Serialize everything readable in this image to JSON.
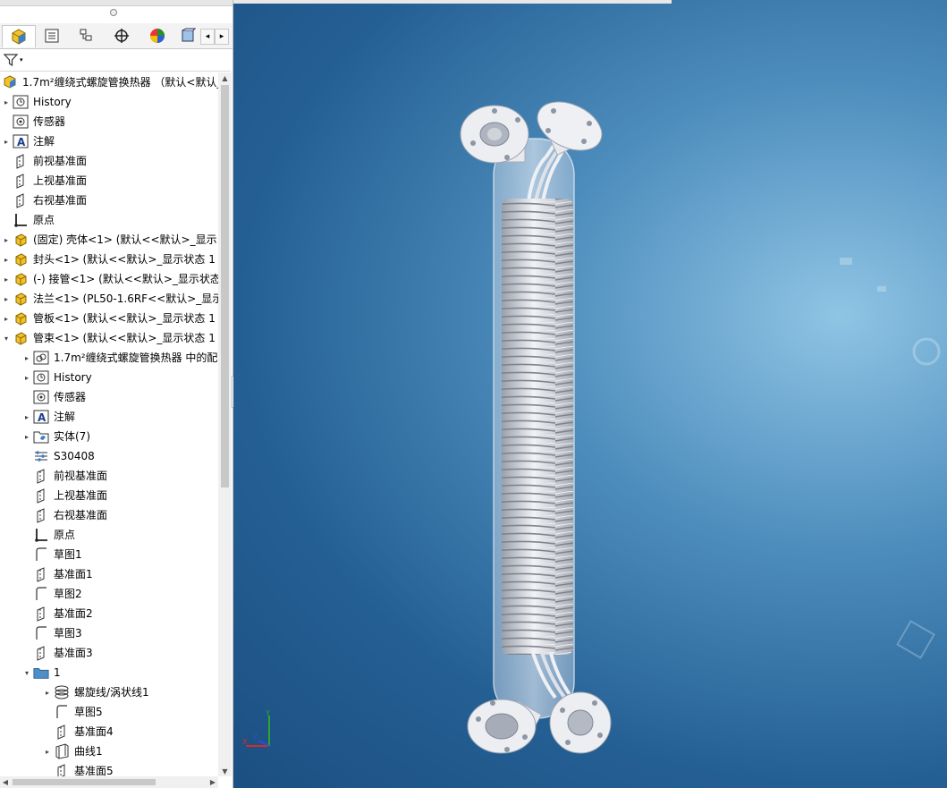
{
  "tree": {
    "root": "1.7m²缠绕式螺旋管换热器 （默认<默认_显",
    "items": [
      {
        "label": "History",
        "arrow": "▸",
        "icon": "history-icon",
        "indent": 0
      },
      {
        "label": "传感器",
        "arrow": "",
        "icon": "sensor-icon",
        "indent": 0
      },
      {
        "label": "注解",
        "arrow": "▸",
        "icon": "annotation-icon",
        "indent": 0
      },
      {
        "label": "前视基准面",
        "arrow": "",
        "icon": "plane-icon",
        "indent": 0
      },
      {
        "label": "上视基准面",
        "arrow": "",
        "icon": "plane-icon",
        "indent": 0
      },
      {
        "label": "右视基准面",
        "arrow": "",
        "icon": "plane-icon",
        "indent": 0
      },
      {
        "label": "原点",
        "arrow": "",
        "icon": "origin-icon",
        "indent": 0
      },
      {
        "label": "(固定) 壳体<1> (默认<<默认>_显示",
        "arrow": "▸",
        "icon": "part-icon",
        "indent": 0
      },
      {
        "label": "封头<1> (默认<<默认>_显示状态 1",
        "arrow": "▸",
        "icon": "part-icon",
        "indent": 0
      },
      {
        "label": "(-) 接管<1> (默认<<默认>_显示状态",
        "arrow": "▸",
        "icon": "part-icon",
        "indent": 0
      },
      {
        "label": "法兰<1> (PL50-1.6RF<<默认>_显示",
        "arrow": "▸",
        "icon": "part-icon",
        "indent": 0
      },
      {
        "label": "管板<1> (默认<<默认>_显示状态 1",
        "arrow": "▸",
        "icon": "part-icon",
        "indent": 0
      },
      {
        "label": "管束<1> (默认<<默认>_显示状态 1",
        "arrow": "▾",
        "icon": "part-icon",
        "indent": 0
      },
      {
        "label": "1.7m²缠绕式螺旋管换热器 中的配",
        "arrow": "▸",
        "icon": "mate-icon",
        "indent": 1
      },
      {
        "label": "History",
        "arrow": "▸",
        "icon": "history-icon",
        "indent": 1
      },
      {
        "label": "传感器",
        "arrow": "",
        "icon": "sensor-icon",
        "indent": 1
      },
      {
        "label": "注解",
        "arrow": "▸",
        "icon": "annotation-icon",
        "indent": 1
      },
      {
        "label": "实体(7)",
        "arrow": "▸",
        "icon": "solid-folder-icon",
        "indent": 1
      },
      {
        "label": "S30408",
        "arrow": "",
        "icon": "material-icon",
        "indent": 1
      },
      {
        "label": "前视基准面",
        "arrow": "",
        "icon": "plane-icon",
        "indent": 1
      },
      {
        "label": "上视基准面",
        "arrow": "",
        "icon": "plane-icon",
        "indent": 1
      },
      {
        "label": "右视基准面",
        "arrow": "",
        "icon": "plane-icon",
        "indent": 1
      },
      {
        "label": "原点",
        "arrow": "",
        "icon": "origin-icon",
        "indent": 1
      },
      {
        "label": "草图1",
        "arrow": "",
        "icon": "sketch-icon",
        "indent": 1
      },
      {
        "label": "基准面1",
        "arrow": "",
        "icon": "plane-icon",
        "indent": 1
      },
      {
        "label": "草图2",
        "arrow": "",
        "icon": "sketch-icon",
        "indent": 1
      },
      {
        "label": "基准面2",
        "arrow": "",
        "icon": "plane-icon",
        "indent": 1
      },
      {
        "label": "草图3",
        "arrow": "",
        "icon": "sketch-icon",
        "indent": 1
      },
      {
        "label": "基准面3",
        "arrow": "",
        "icon": "plane-icon",
        "indent": 1
      },
      {
        "label": "1",
        "arrow": "▾",
        "icon": "folder-icon",
        "indent": 1
      },
      {
        "label": "螺旋线/涡状线1",
        "arrow": "▸",
        "icon": "helix-icon",
        "indent": 2
      },
      {
        "label": "草图5",
        "arrow": "",
        "icon": "sketch-icon",
        "indent": 2
      },
      {
        "label": "基准面4",
        "arrow": "",
        "icon": "plane-icon",
        "indent": 2
      },
      {
        "label": "曲线1",
        "arrow": "▸",
        "icon": "curve-icon",
        "indent": 2
      },
      {
        "label": "基准面5",
        "arrow": "",
        "icon": "plane-icon",
        "indent": 2
      }
    ]
  },
  "triad": {
    "x": "X",
    "y": "Y",
    "z": "Z"
  }
}
